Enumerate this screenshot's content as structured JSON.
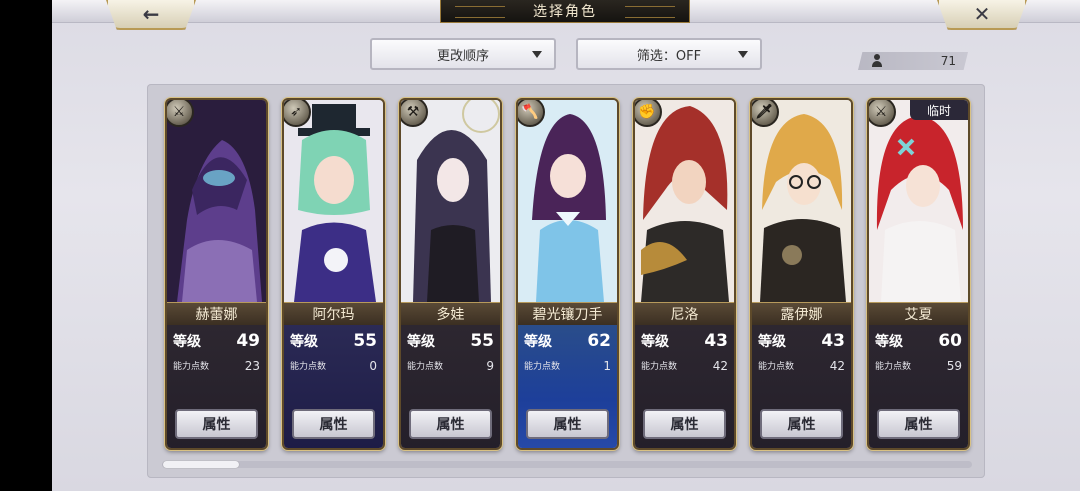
{
  "header": {
    "title": "选择角色",
    "back_icon": "←",
    "close_icon": "✕"
  },
  "controls": {
    "sort_label": "更改顺序",
    "filter_label": "筛选：OFF",
    "roster_count": "71"
  },
  "labels": {
    "level": "等级",
    "ability_points": "能力点数",
    "attribute_button": "属性",
    "temporary": "临时"
  },
  "characters": [
    {
      "name": "赫蕾娜",
      "level": "49",
      "ability_points": "23",
      "class_icon": "crossbow-icon"
    },
    {
      "name": "阿尔玛",
      "level": "55",
      "ability_points": "0",
      "class_icon": "bow-icon"
    },
    {
      "name": "多娃",
      "level": "55",
      "ability_points": "9",
      "class_icon": "hammer-icon"
    },
    {
      "name": "碧光镶刀手",
      "level": "62",
      "ability_points": "1",
      "class_icon": "axe-icon"
    },
    {
      "name": "尼洛",
      "level": "43",
      "ability_points": "42",
      "class_icon": "gauntlet-icon"
    },
    {
      "name": "露伊娜",
      "level": "43",
      "ability_points": "42",
      "class_icon": "sword-icon"
    },
    {
      "name": "艾夏",
      "level": "60",
      "ability_points": "59",
      "class_icon": "crossbow-icon"
    }
  ]
}
